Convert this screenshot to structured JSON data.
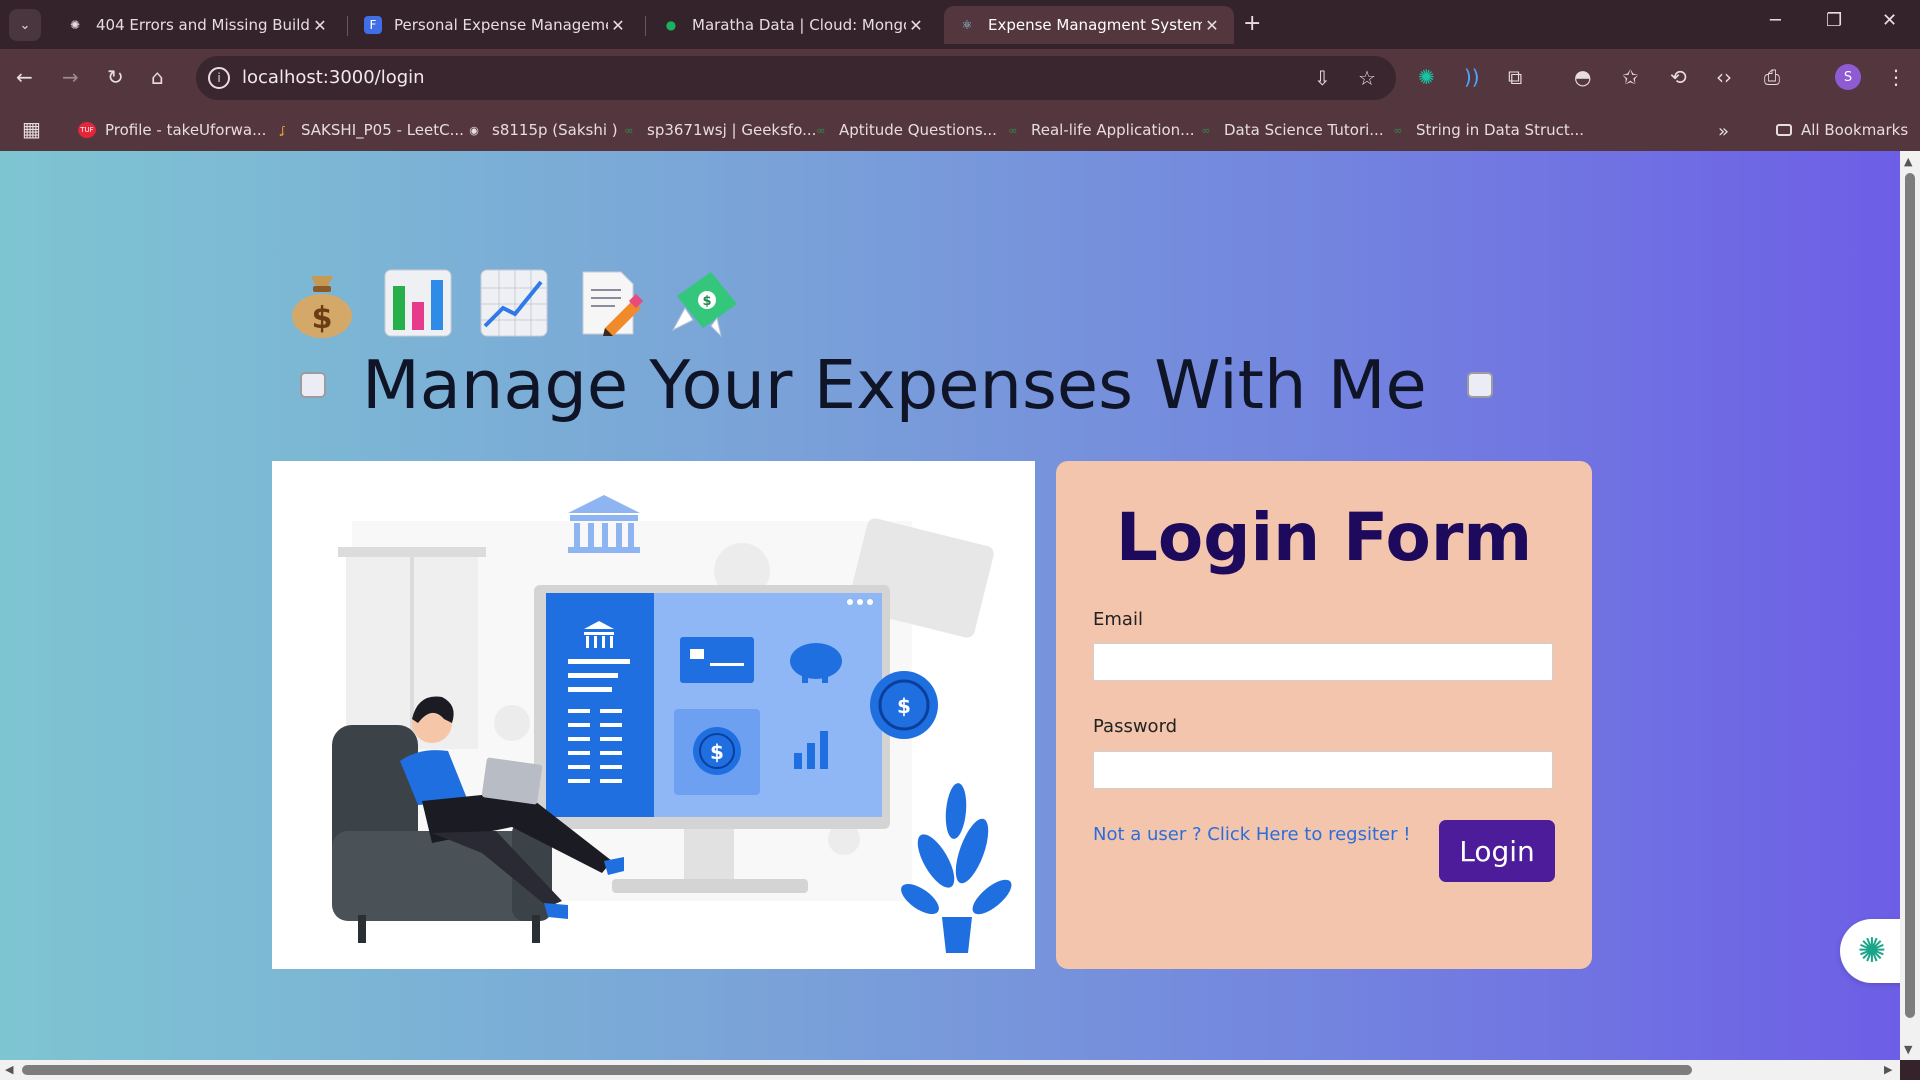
{
  "browser": {
    "tabs": [
      {
        "title": "404 Errors and Missing Build",
        "favicon": "openai-icon"
      },
      {
        "title": "Personal Expense Management",
        "favicon": "forms-icon"
      },
      {
        "title": "Maratha Data | Cloud: MongoD",
        "favicon": "mongodb-leaf-icon"
      },
      {
        "title": "Expense Managment System",
        "favicon": "react-icon",
        "active": true
      }
    ],
    "url": "localhost:3000/login",
    "profile_initial": "S",
    "bookmarks": [
      {
        "label": "Profile - takeUforwa...",
        "icon": "tuf-icon"
      },
      {
        "label": "SAKSHI_P05 - LeetC...",
        "icon": "leetcode-icon"
      },
      {
        "label": "s8115p (Sakshi )",
        "icon": "github-icon"
      },
      {
        "label": "sp3671wsj | Geeksfo...",
        "icon": "gfg-icon"
      },
      {
        "label": "Aptitude Questions...",
        "icon": "gfg-icon"
      },
      {
        "label": "Real-life Application...",
        "icon": "gfg-icon"
      },
      {
        "label": "Data Science Tutori...",
        "icon": "gfg-icon"
      },
      {
        "label": "String in Data Struct...",
        "icon": "gfg-icon"
      }
    ],
    "all_bookmarks": "All Bookmarks"
  },
  "page": {
    "emojis": [
      "money-bag",
      "bar-chart",
      "chart-increasing",
      "memo",
      "money-with-wings"
    ],
    "hero_title": "Manage Your Expenses With Me",
    "login": {
      "heading": "Login Form",
      "email_label": "Email",
      "email_value": "",
      "password_label": "Password",
      "password_value": "",
      "register_link": "Not a user ? Click Here to regsiter !",
      "login_button": "Login"
    }
  },
  "colors": {
    "gradient_start": "#7ec5d2",
    "gradient_end": "#6d5ee6",
    "login_card": "#f4c5ad",
    "heading": "#1e0a5c",
    "button": "#4d1c9a",
    "link": "#2b6ed8"
  }
}
